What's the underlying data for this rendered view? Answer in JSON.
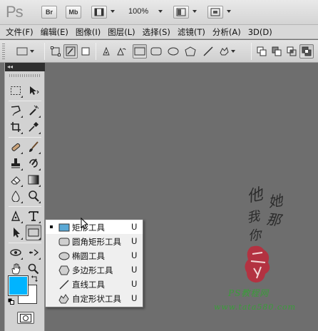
{
  "appbar": {
    "logo": "Ps",
    "bridge_label": "Br",
    "minibridge_label": "Mb",
    "zoom": "100%"
  },
  "menu": [
    "文件(F)",
    "编辑(E)",
    "图像(I)",
    "图层(L)",
    "选择(S)",
    "滤镜(T)",
    "分析(A)",
    "3D(D)"
  ],
  "tool_panel": {
    "collapse_label": "◂◂"
  },
  "flyout": {
    "items": [
      {
        "label": "矩形工具",
        "key": "U",
        "selected": true,
        "icon": "rectangle-icon"
      },
      {
        "label": "圆角矩形工具",
        "key": "U",
        "selected": false,
        "icon": "rounded-rectangle-icon"
      },
      {
        "label": "椭圆工具",
        "key": "U",
        "selected": false,
        "icon": "ellipse-icon"
      },
      {
        "label": "多边形工具",
        "key": "U",
        "selected": false,
        "icon": "polygon-icon"
      },
      {
        "label": "直线工具",
        "key": "U",
        "selected": false,
        "icon": "line-icon"
      },
      {
        "label": "自定形状工具",
        "key": "U",
        "selected": false,
        "icon": "custom-shape-icon"
      }
    ]
  },
  "colors": {
    "foreground": "#00b4ff",
    "background": "#ffffff",
    "canvas": "#6e6e6e",
    "watermark_green": "#3a9d3a",
    "seal_red": "#c0283a"
  },
  "watermark": {
    "chars": [
      "他",
      "她",
      "我",
      "那",
      "你"
    ],
    "site_name": "PS教程网",
    "url": "www.tata580.com"
  }
}
